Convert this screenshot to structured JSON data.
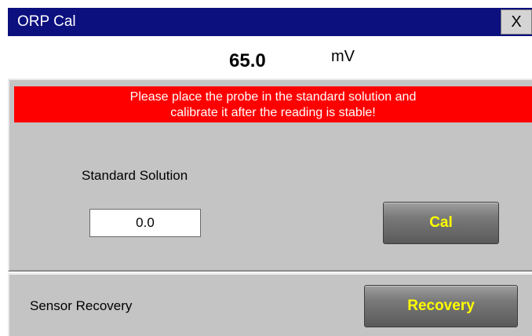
{
  "window": {
    "title": "ORP Cal",
    "close_label": "X"
  },
  "reading": {
    "value": "65.0",
    "unit": "mV"
  },
  "warning": {
    "line1": "Please place the probe in the standard solution and",
    "line2": "calibrate it after the reading is stable!"
  },
  "standard_solution": {
    "label": "Standard Solution",
    "value": "0.0"
  },
  "cal_button": {
    "label": "Cal"
  },
  "recovery": {
    "label": "Sensor Recovery",
    "button_label": "Recovery"
  },
  "colors": {
    "titlebar": "#0c0f7e",
    "warning_bg": "#ff0000",
    "panel_bg": "#c4c4c4",
    "button_text": "#ffff00"
  }
}
